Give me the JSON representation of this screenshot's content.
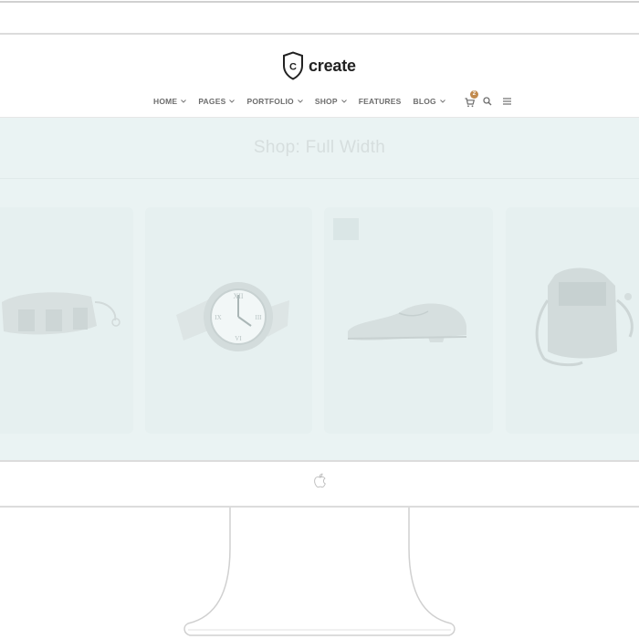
{
  "site": {
    "logo_letter": "C",
    "logo_text": "create"
  },
  "nav": {
    "items": [
      {
        "label": "HOME",
        "has_dropdown": true
      },
      {
        "label": "PAGES",
        "has_dropdown": true
      },
      {
        "label": "PORTFOLIO",
        "has_dropdown": true
      },
      {
        "label": "SHOP",
        "has_dropdown": true
      },
      {
        "label": "FEATURES",
        "has_dropdown": false
      },
      {
        "label": "BLOG",
        "has_dropdown": true
      }
    ],
    "cart_count": "2",
    "icons": [
      "cart-icon",
      "search-icon",
      "menu-icon"
    ]
  },
  "page": {
    "title": "Shop: Full Width"
  },
  "products": [
    {
      "name": "bag",
      "image": "camera-bag"
    },
    {
      "name": "watch",
      "image": "wristwatch"
    },
    {
      "name": "shoe",
      "image": "leather-shoe",
      "on_sale": true
    },
    {
      "name": "backpack",
      "image": "leather-bag"
    }
  ],
  "colors": {
    "accent": "#c18a4e",
    "content_bg": "#eaf3f3",
    "nav_text": "#6d6d6d",
    "monitor_outline": "#cfcfcf"
  },
  "device": {
    "brand_icon": "apple-icon"
  }
}
